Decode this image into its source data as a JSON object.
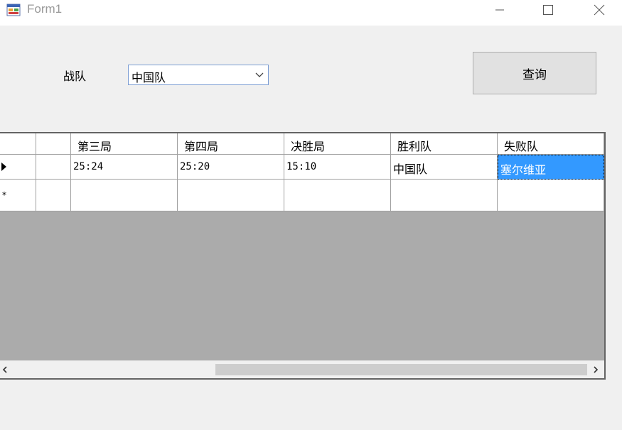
{
  "window": {
    "title": "Form1",
    "icon": "form-app-icon",
    "controls": [
      "minimize-icon",
      "maximize-icon",
      "close-icon"
    ]
  },
  "filter": {
    "label": "战队",
    "selected": "中国队"
  },
  "query_button": {
    "label": "查询"
  },
  "grid": {
    "columns": [
      "",
      "第三局",
      "第四局",
      "决胜局",
      "胜利队",
      "失败队"
    ],
    "rows": [
      [
        "",
        "25:24",
        "25:20",
        "15:10",
        "中国队",
        "塞尔维亚"
      ]
    ],
    "selected_cell": {
      "row": 0,
      "column": 5
    },
    "colors": {
      "selection": "#3399ff",
      "empty_area": "#ababab"
    },
    "hscroll": {
      "thumb_start": 0.34,
      "thumb_size": 0.63
    }
  }
}
